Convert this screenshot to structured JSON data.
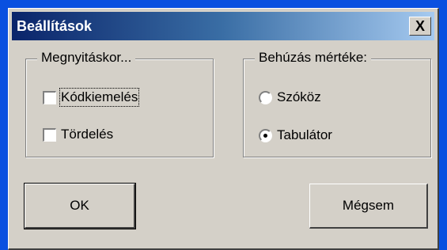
{
  "dialog": {
    "title": "Beállítások",
    "close_label": "X"
  },
  "group_open": {
    "legend": "Megnyitáskor...",
    "options": [
      {
        "label": "Kódkiemelés",
        "checked": false,
        "focused": true
      },
      {
        "label": "Tördelés",
        "checked": false
      }
    ]
  },
  "group_indent": {
    "legend": "Behúzás mértéke:",
    "options": [
      {
        "label": "Szóköz",
        "selected": false
      },
      {
        "label": "Tabulátor",
        "selected": true
      }
    ]
  },
  "buttons": {
    "ok": "OK",
    "cancel": "Mégsem"
  }
}
